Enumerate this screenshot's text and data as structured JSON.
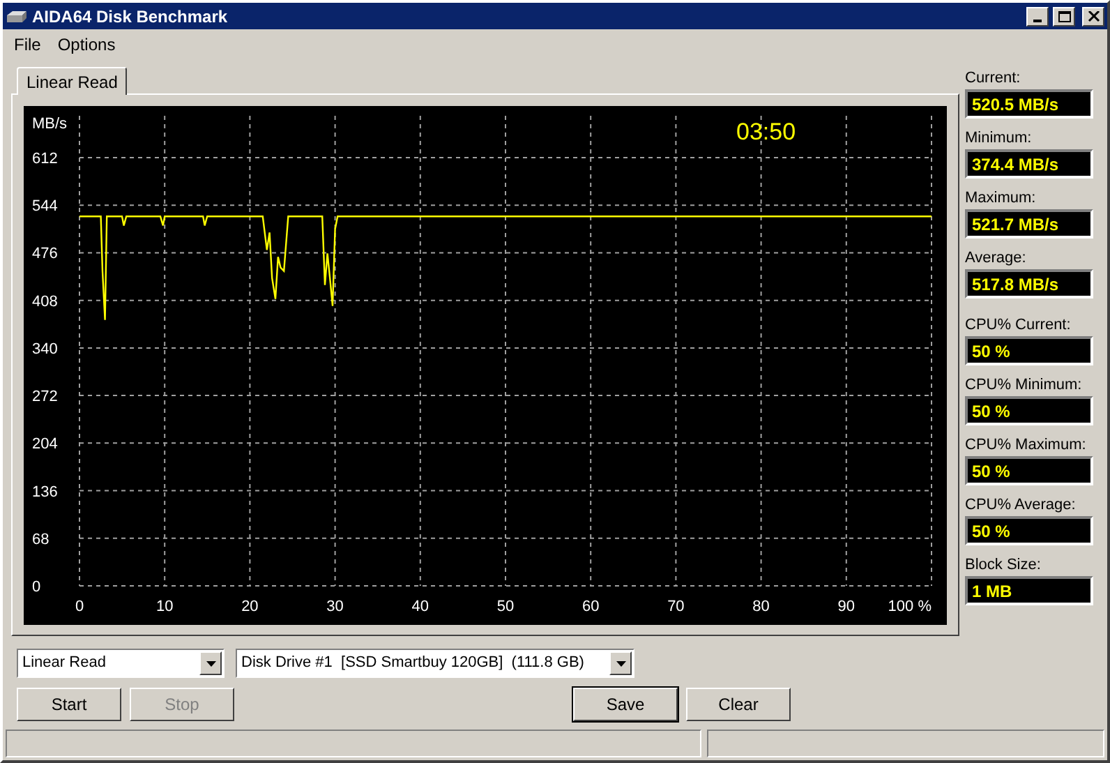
{
  "window": {
    "title": "AIDA64 Disk Benchmark"
  },
  "menu": [
    "File",
    "Options"
  ],
  "tabs": [
    {
      "label": "Linear Read",
      "selected": true
    }
  ],
  "chart": {
    "timer": "03:50",
    "chart_data": {
      "type": "line",
      "ylabel": "MB/s",
      "x": [
        0,
        2.5,
        2.7,
        3,
        3.2,
        5,
        5.2,
        5.5,
        9.5,
        9.8,
        10,
        14.5,
        14.7,
        15,
        21.5,
        22,
        22.3,
        22.6,
        23,
        23.3,
        23.6,
        24,
        24.5,
        28.5,
        28.8,
        29.1,
        29.4,
        29.7,
        30,
        30.3,
        100
      ],
      "grid": true,
      "series": [
        {
          "color": "#ffff00",
          "values": [
            528,
            528,
            450,
            380,
            528,
            528,
            515,
            528,
            528,
            515,
            528,
            528,
            515,
            528,
            528,
            480,
            505,
            440,
            410,
            470,
            455,
            450,
            528,
            528,
            430,
            475,
            440,
            400,
            510,
            528,
            528
          ]
        }
      ],
      "xlim": [
        0,
        100
      ],
      "ylim": [
        0,
        612
      ],
      "xticks": [
        0,
        10,
        20,
        30,
        40,
        50,
        60,
        70,
        80,
        90,
        {
          "value": 100,
          "label": "100 %"
        }
      ],
      "yticks": [
        0,
        68,
        136,
        204,
        272,
        340,
        408,
        476,
        544,
        612
      ]
    }
  },
  "readouts": [
    {
      "label": "Current:",
      "value": "520.5 MB/s"
    },
    {
      "label": "Minimum:",
      "value": "374.4 MB/s"
    },
    {
      "label": "Maximum:",
      "value": "521.7 MB/s"
    },
    {
      "label": "Average:",
      "value": "517.8 MB/s"
    },
    {
      "label": "CPU% Current:",
      "value": "50 %"
    },
    {
      "label": "CPU% Minimum:",
      "value": "50 %"
    },
    {
      "label": "CPU% Maximum:",
      "value": "50 %"
    },
    {
      "label": "CPU% Average:",
      "value": "50 %"
    },
    {
      "label": "Block Size:",
      "value": "1 MB"
    }
  ],
  "test_select": {
    "value": "Linear Read"
  },
  "drive_select": {
    "value": "Disk Drive #1  [SSD Smartbuy 120GB]  (111.8 GB)"
  },
  "buttons": [
    {
      "label": "Start",
      "disabled": false,
      "default": false
    },
    {
      "label": "Stop",
      "disabled": true,
      "default": false
    },
    {
      "label": "Save",
      "disabled": false,
      "default": true
    },
    {
      "label": "Clear",
      "disabled": false,
      "default": false
    }
  ]
}
